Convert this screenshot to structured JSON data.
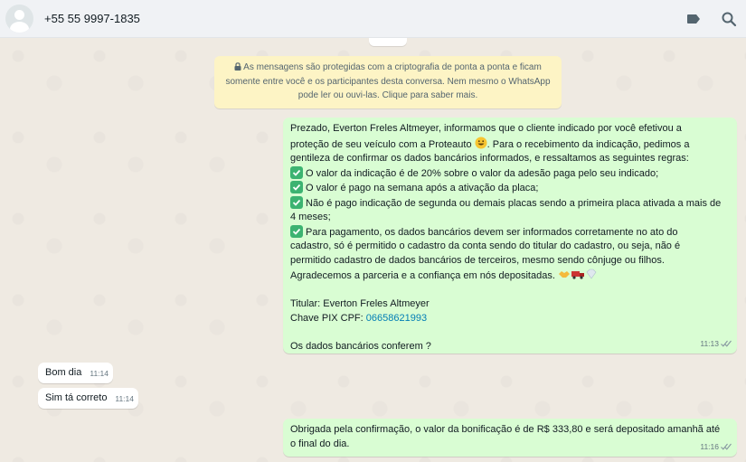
{
  "header": {
    "contact_name": "+55 55 9997-1835",
    "icons": [
      "avatar-placeholder",
      "label-icon",
      "search-icon"
    ]
  },
  "encryption_notice": {
    "line1": "As mensagens são protegidas com a criptografia de ponta a ponta e ficam",
    "line2": "somente entre você e os participantes desta conversa. Nem mesmo o WhatsApp",
    "line3": "pode ler ou ouvi-las. Clique para saber mais."
  },
  "messages": [
    {
      "direction": "out",
      "time": "11:13",
      "lines": [
        "Prezado, Everton Freles Altmeyer, informamos que o cliente indicado por você efetivou a",
        "proteção de seu veículo com a Proteauto",
        "Para o recebimento da indicação, pedimos a",
        "gentileza de confirmar os dados bancários informados, e  ressaltamos as seguintes regras:",
        "O valor da indicação é de 20% sobre o valor da adesão paga pelo seu indicado;",
        "O valor é pago na semana após a ativação da placa;",
        "Não é pago indicação de segunda ou demais placas sendo a primeira placa ativada a mais de",
        "4 meses;",
        "Para pagamento, os dados bancários devem ser informados corretamente no ato do",
        "cadastro, só é permitido o cadastro da conta sendo do titular do cadastro, ou seja, não é",
        "permitido cadastro de dados bancários de terceiros, mesmo sendo cônjuge ou filhos.",
        "Agradecemos a parceria e a confiança em nós depositadas.",
        "Titular: Everton Freles Altmeyer",
        "Chave PIX CPF: ",
        "06658621993",
        "Os dados bancários conferem ?"
      ]
    },
    {
      "direction": "in",
      "time": "11:14",
      "text": "Bom dia"
    },
    {
      "direction": "in",
      "time": "11:14",
      "text": "Sim tá correto"
    },
    {
      "direction": "out",
      "time": "11:16",
      "lines": [
        "Obrigada pela confirmação, o valor da bonificação é de R$ 333,80 e será depositado amanhã até",
        "o final do dia."
      ]
    }
  ],
  "colors": {
    "chat_bg": "#efeae2",
    "outgoing_bubble": "#d9fdd3",
    "incoming_bubble": "#ffffff",
    "notice_bg": "#fdf4c5",
    "link": "#027eb5",
    "header_bg": "#f0f2f5"
  }
}
